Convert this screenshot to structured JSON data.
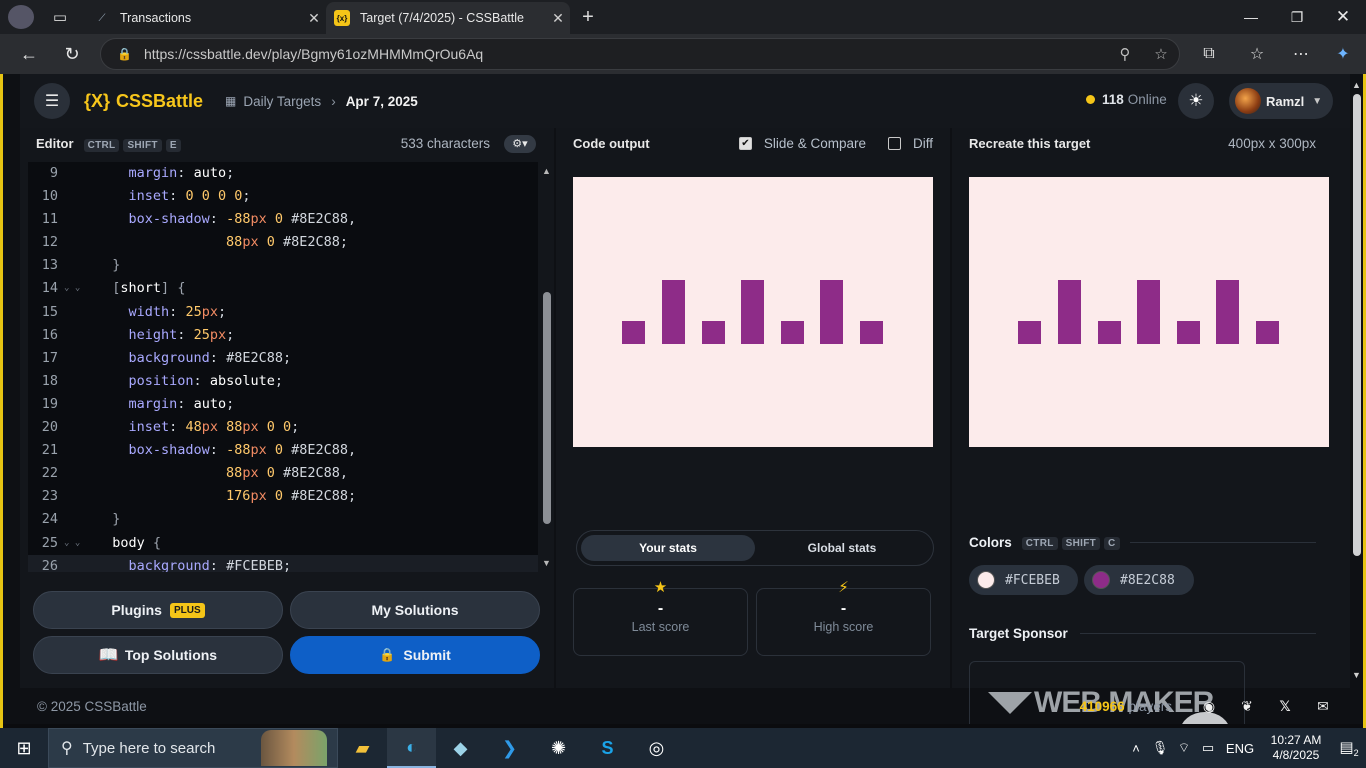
{
  "browser": {
    "tabs": [
      {
        "title": "Transactions",
        "icon": "bank-icon"
      },
      {
        "title": "Target (7/4/2025) - CSSBattle",
        "icon": "cssbattle-icon",
        "active": true
      }
    ],
    "url": "https://cssbattle.dev/play/Bgmy61ozMHMMmQrOu6Aq"
  },
  "nav": {
    "logo_mark": "{X}",
    "logo_text": "CSSBattle",
    "breadcrumb_section": "Daily Targets",
    "breadcrumb_date": "Apr 7, 2025",
    "online_count": "118",
    "online_label": "Online",
    "user_name": "Ramzl"
  },
  "editor": {
    "title": "Editor",
    "shortcut": [
      "CTRL",
      "SHIFT",
      "E"
    ],
    "char_count": "533 characters",
    "lines": [
      {
        "n": "9",
        "html": "    <span class='p'>margin</span><span class='c'>:</span> <span class='s'>auto</span><span class='c'>;</span>"
      },
      {
        "n": "10",
        "html": "    <span class='p'>inset</span><span class='c'>:</span> <span class='n'>0 0 0 0</span><span class='c'>;</span>"
      },
      {
        "n": "11",
        "html": "    <span class='p'>box-shadow</span><span class='c'>:</span> <span class='n'>-88</span><span class='u'>px</span> <span class='n'>0</span> <span class='c'>#8E2C88,</span>"
      },
      {
        "n": "12",
        "html": "                <span class='n'>88</span><span class='u'>px</span> <span class='n'>0</span> <span class='c'>#8E2C88;</span>"
      },
      {
        "n": "13",
        "html": "  <span class='b'>}</span>"
      },
      {
        "n": "14",
        "fold": true,
        "html": "  <span class='b'>[</span><span class='s'>short</span><span class='b'>]</span> <span class='b'>{</span>"
      },
      {
        "n": "15",
        "html": "    <span class='p'>width</span><span class='c'>:</span> <span class='n'>25</span><span class='u'>px</span><span class='c'>;</span>"
      },
      {
        "n": "16",
        "html": "    <span class='p'>height</span><span class='c'>:</span> <span class='n'>25</span><span class='u'>px</span><span class='c'>;</span>"
      },
      {
        "n": "17",
        "html": "    <span class='p'>background</span><span class='c'>:</span> <span class='c'>#8E2C88;</span>"
      },
      {
        "n": "18",
        "html": "    <span class='p'>position</span><span class='c'>:</span> <span class='s'>absolute</span><span class='c'>;</span>"
      },
      {
        "n": "19",
        "html": "    <span class='p'>margin</span><span class='c'>:</span> <span class='s'>auto</span><span class='c'>;</span>"
      },
      {
        "n": "20",
        "html": "    <span class='p'>inset</span><span class='c'>:</span> <span class='n'>48</span><span class='u'>px</span> <span class='n'>88</span><span class='u'>px</span> <span class='n'>0 0</span><span class='c'>;</span>"
      },
      {
        "n": "21",
        "html": "    <span class='p'>box-shadow</span><span class='c'>:</span> <span class='n'>-88</span><span class='u'>px</span> <span class='n'>0</span> <span class='c'>#8E2C88,</span>"
      },
      {
        "n": "22",
        "html": "                <span class='n'>88</span><span class='u'>px</span> <span class='n'>0</span> <span class='c'>#8E2C88,</span>"
      },
      {
        "n": "23",
        "html": "                <span class='n'>176</span><span class='u'>px</span> <span class='n'>0</span> <span class='c'>#8E2C88;</span>"
      },
      {
        "n": "24",
        "html": "  <span class='b'>}</span>"
      },
      {
        "n": "25",
        "fold": true,
        "html": "  <span class='s'>body</span> <span class='b'>{</span>"
      },
      {
        "n": "26",
        "active": true,
        "html": "    <span class='p'>background</span><span class='c'>:</span> <span class='c'>#FCEBEB;</span>"
      }
    ],
    "buttons": {
      "plugins": "Plugins",
      "plugins_badge": "PLUS",
      "my_solutions": "My Solutions",
      "top_solutions": "Top Solutions",
      "submit": "Submit"
    }
  },
  "output": {
    "title": "Code output",
    "slide_compare": "Slide & Compare",
    "slide_compare_checked": true,
    "diff": "Diff",
    "diff_checked": false,
    "stats_tabs": [
      "Your stats",
      "Global stats"
    ],
    "last_score_value": "-",
    "last_score_label": "Last score",
    "high_score_value": "-",
    "high_score_label": "High score"
  },
  "target": {
    "title": "Recreate this target",
    "dimensions": "400px x 300px",
    "colors_title": "Colors",
    "colors_shortcut": [
      "CTRL",
      "SHIFT",
      "C"
    ],
    "colors": [
      "#FCEBEB",
      "#8E2C88"
    ],
    "sponsor_title": "Target Sponsor",
    "sponsor_logo": "WEB MAKER"
  },
  "footer": {
    "copyright": "© 2025 CSSBattle",
    "players_count": "410966",
    "players_label": "players"
  },
  "taskbar": {
    "search_placeholder": "Type here to search",
    "language": "ENG",
    "time": "10:27 AM",
    "date": "4/8/2025",
    "notifications": "2"
  },
  "theme": {
    "accent": "#F5C518",
    "canvas_bg": "#FCEBEB",
    "shape_color": "#8E2C88",
    "submit_color": "#0E5FC7"
  }
}
